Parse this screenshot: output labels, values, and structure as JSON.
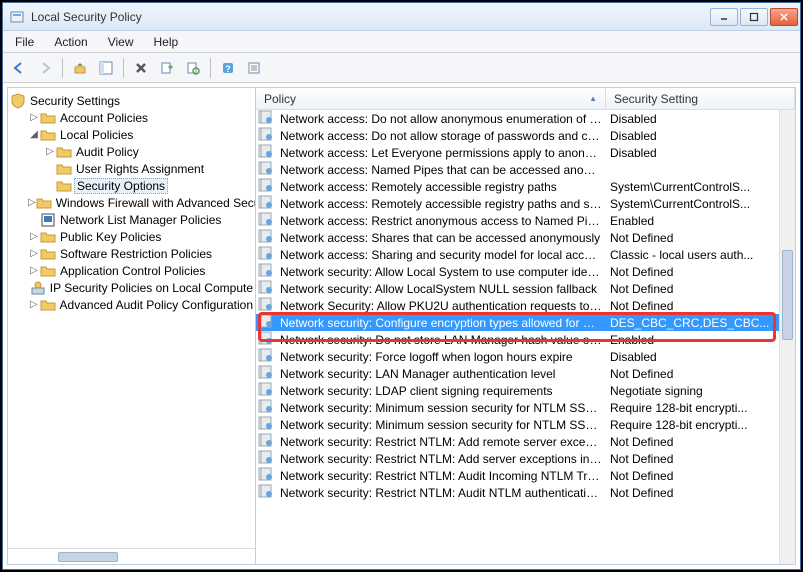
{
  "window": {
    "title": "Local Security Policy"
  },
  "menu": {
    "file": "File",
    "action": "Action",
    "view": "View",
    "help": "Help"
  },
  "tree": {
    "root": "Security Settings",
    "items": [
      {
        "label": "Account Policies",
        "depth": 1,
        "expander": "▷",
        "icon": "folder"
      },
      {
        "label": "Local Policies",
        "depth": 1,
        "expander": "◢",
        "icon": "folder"
      },
      {
        "label": "Audit Policy",
        "depth": 2,
        "expander": "▷",
        "icon": "folder"
      },
      {
        "label": "User Rights Assignment",
        "depth": 2,
        "expander": "",
        "icon": "folder"
      },
      {
        "label": "Security Options",
        "depth": 2,
        "expander": "",
        "icon": "folder",
        "selected": true
      },
      {
        "label": "Windows Firewall with Advanced Secu",
        "depth": 1,
        "expander": "▷",
        "icon": "folder"
      },
      {
        "label": "Network List Manager Policies",
        "depth": 1,
        "expander": "",
        "icon": "net"
      },
      {
        "label": "Public Key Policies",
        "depth": 1,
        "expander": "▷",
        "icon": "folder"
      },
      {
        "label": "Software Restriction Policies",
        "depth": 1,
        "expander": "▷",
        "icon": "folder"
      },
      {
        "label": "Application Control Policies",
        "depth": 1,
        "expander": "▷",
        "icon": "folder"
      },
      {
        "label": "IP Security Policies on Local Compute",
        "depth": 1,
        "expander": "",
        "icon": "ipsec"
      },
      {
        "label": "Advanced Audit Policy Configuration",
        "depth": 1,
        "expander": "▷",
        "icon": "folder"
      }
    ]
  },
  "list": {
    "headers": {
      "policy": "Policy",
      "setting": "Security Setting"
    },
    "rows": [
      {
        "p": "Network access: Do not allow anonymous enumeration of S...",
        "s": "Disabled"
      },
      {
        "p": "Network access: Do not allow storage of passwords and cre...",
        "s": "Disabled"
      },
      {
        "p": "Network access: Let Everyone permissions apply to anonym...",
        "s": "Disabled"
      },
      {
        "p": "Network access: Named Pipes that can be accessed anonym...",
        "s": ""
      },
      {
        "p": "Network access: Remotely accessible registry paths",
        "s": "System\\CurrentControlS..."
      },
      {
        "p": "Network access: Remotely accessible registry paths and sub...",
        "s": "System\\CurrentControlS..."
      },
      {
        "p": "Network access: Restrict anonymous access to Named Pipes...",
        "s": "Enabled"
      },
      {
        "p": "Network access: Shares that can be accessed anonymously",
        "s": "Not Defined"
      },
      {
        "p": "Network access: Sharing and security model for local accou...",
        "s": "Classic - local users auth..."
      },
      {
        "p": "Network security: Allow Local System to use computer ident...",
        "s": "Not Defined"
      },
      {
        "p": "Network security: Allow LocalSystem NULL session fallback",
        "s": "Not Defined"
      },
      {
        "p": "Network Security: Allow PKU2U authentication requests to t...",
        "s": "Not Defined"
      },
      {
        "p": "Network security: Configure encryption types allowed for Ke...",
        "s": "DES_CBC_CRC,DES_CBC...",
        "selected": true
      },
      {
        "p": "Network security: Do not store LAN Manager hash value on ...",
        "s": "Enabled"
      },
      {
        "p": "Network security: Force logoff when logon hours expire",
        "s": "Disabled"
      },
      {
        "p": "Network security: LAN Manager authentication level",
        "s": "Not Defined"
      },
      {
        "p": "Network security: LDAP client signing requirements",
        "s": "Negotiate signing"
      },
      {
        "p": "Network security: Minimum session security for NTLM SSP ...",
        "s": "Require 128-bit encrypti..."
      },
      {
        "p": "Network security: Minimum session security for NTLM SSP ...",
        "s": "Require 128-bit encrypti..."
      },
      {
        "p": "Network security: Restrict NTLM: Add remote server excepti...",
        "s": "Not Defined"
      },
      {
        "p": "Network security: Restrict NTLM: Add server exceptions in t...",
        "s": "Not Defined"
      },
      {
        "p": "Network security: Restrict NTLM: Audit Incoming NTLM Tra...",
        "s": "Not Defined"
      },
      {
        "p": "Network security: Restrict NTLM: Audit NTLM authenticatio...",
        "s": "Not Defined"
      }
    ]
  }
}
